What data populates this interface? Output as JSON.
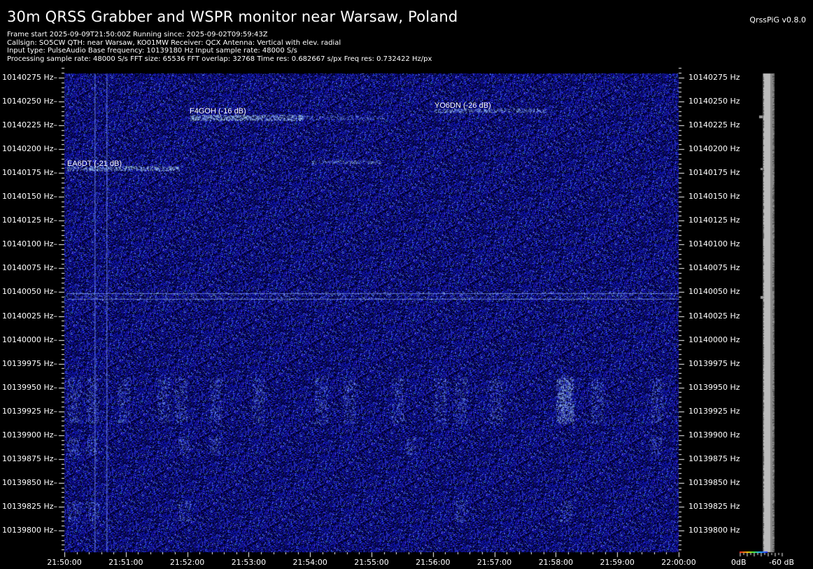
{
  "header": {
    "title": "30m QRSS Grabber and WSPR monitor near Warsaw, Poland",
    "version": "QrssPiG v0.8.0",
    "info_lines": [
      "Frame start 2025-09-09T21:50:00Z Running since: 2025-09-02T09:59:43Z",
      "Callsign: SO5CW QTH: near Warsaw, KO01MW Receiver: QCX Antenna: Vertical with elev. radial",
      "Input type: PulseAudio Base frequency: 10139180 Hz Input sample rate: 48000 S/s",
      "Processing sample rate: 48000 S/s FFT size: 65536 FFT overlap: 32768 Time res: 0.682667 s/px Freq res: 0.732422 Hz/px"
    ]
  },
  "spectrogram": {
    "freq_labels": [
      "10140275 Hz",
      "10140250 Hz",
      "10140225 Hz",
      "10140200 Hz",
      "10140175 Hz",
      "10140150 Hz",
      "10140125 Hz",
      "10140100 Hz",
      "10140075 Hz",
      "10140050 Hz",
      "10140025 Hz",
      "10140000 Hz",
      "10139975 Hz",
      "10139950 Hz",
      "10139925 Hz",
      "10139900 Hz",
      "10139875 Hz",
      "10139850 Hz",
      "10139825 Hz",
      "10139800 Hz"
    ],
    "time_labels": [
      "21:50:00",
      "21:51:00",
      "21:52:00",
      "21:53:00",
      "21:54:00",
      "21:55:00",
      "21:56:00",
      "21:57:00",
      "21:58:00",
      "21:59:00",
      "22:00:00"
    ],
    "spots": [
      {
        "label": "EA6DT (-21 dB)"
      },
      {
        "label": "F4GOH (-16 dB)"
      },
      {
        "label": "YO6DN (-26 dB)"
      }
    ],
    "colors": {
      "background": "#1414b8",
      "signal": "#a0d8ff",
      "trace": "#bbbbbb"
    }
  },
  "scale": {
    "left_label": "0dB",
    "right_label": "-60 dB"
  }
}
